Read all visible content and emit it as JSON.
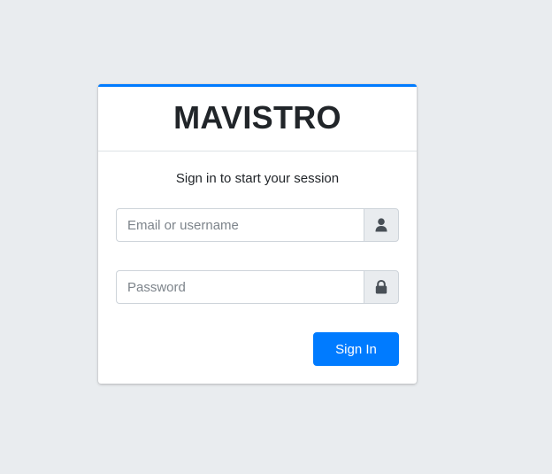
{
  "brand": {
    "name": "MAVISTRO"
  },
  "login": {
    "message": "Sign in to start your session",
    "email_placeholder": "Email or username",
    "email_value": "",
    "email_icon": "user-icon",
    "password_placeholder": "Password",
    "password_value": "",
    "password_icon": "lock-icon",
    "submit_label": "Sign In"
  },
  "colors": {
    "page_background": "#e9ecef",
    "accent": "#007bff",
    "card_background": "#ffffff",
    "addon_background": "#e9ecef",
    "icon_color": "#495057"
  }
}
